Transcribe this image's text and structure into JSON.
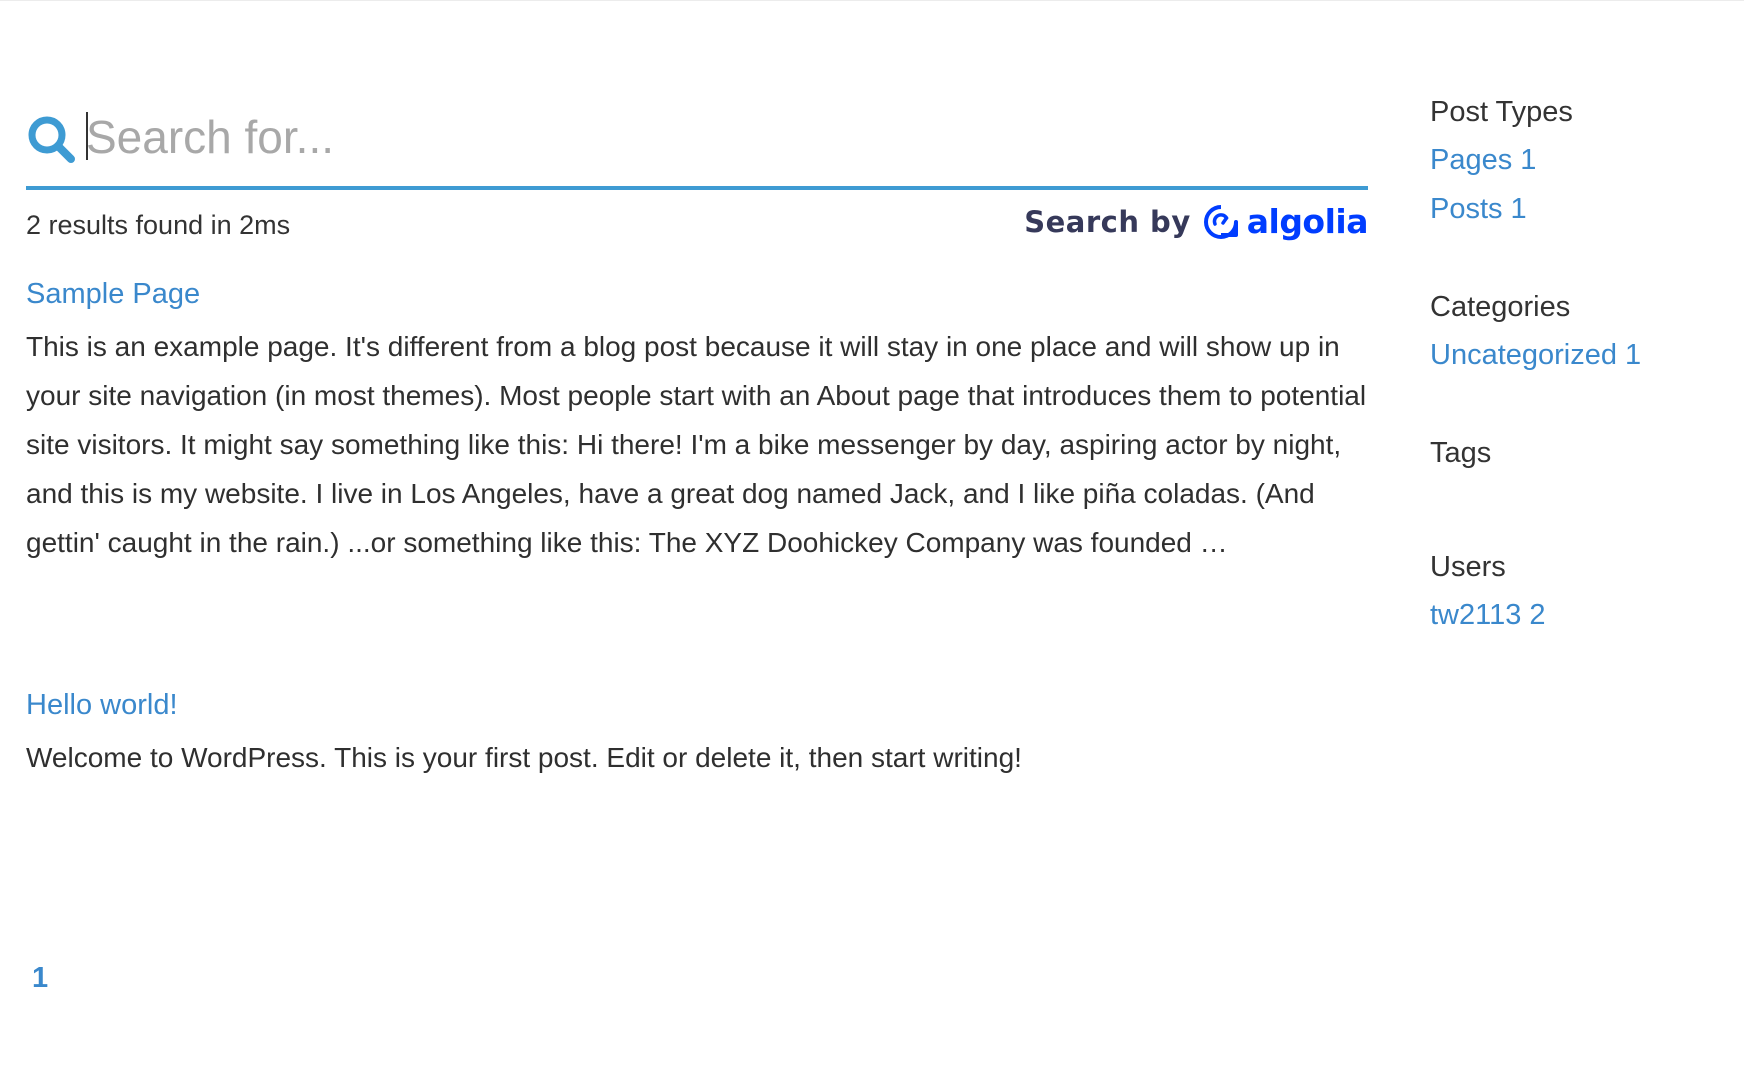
{
  "search": {
    "placeholder": "Search for...",
    "value": "",
    "results_text": "2 results found in 2ms",
    "powered_by_label": "Search by",
    "brand_name": "algolia"
  },
  "hits": [
    {
      "title": "Sample Page",
      "excerpt": "This is an example page. It's different from a blog post because it will stay in one place and will show up in your site navigation (in most themes). Most people start with an About page that introduces them to potential site visitors. It might say something like this: Hi there! I'm a bike messenger by day, aspiring actor by night, and this is my website. I live in Los Angeles, have a great dog named Jack, and I like piña coladas. (And gettin' caught in the rain.) ...or something like this: The XYZ Doohickey Company was founded …"
    },
    {
      "title": "Hello world!",
      "excerpt": "Welcome to WordPress. This is your first post. Edit or delete it, then start writing!"
    }
  ],
  "pagination": {
    "pages": [
      "1"
    ]
  },
  "facets": {
    "post_types": {
      "title": "Post Types",
      "items": [
        {
          "label": "Pages",
          "count": "1"
        },
        {
          "label": "Posts",
          "count": "1"
        }
      ]
    },
    "categories": {
      "title": "Categories",
      "items": [
        {
          "label": "Uncategorized",
          "count": "1"
        }
      ]
    },
    "tags": {
      "title": "Tags",
      "items": []
    },
    "users": {
      "title": "Users",
      "items": [
        {
          "label": "tw2113",
          "count": "2"
        }
      ]
    }
  },
  "colors": {
    "accent": "#3e9bd3",
    "link": "#3a88cc",
    "algolia_blue": "#003dff",
    "text": "#333333"
  },
  "icons": {
    "search": "search-icon",
    "algolia": "algolia-logo-icon"
  }
}
